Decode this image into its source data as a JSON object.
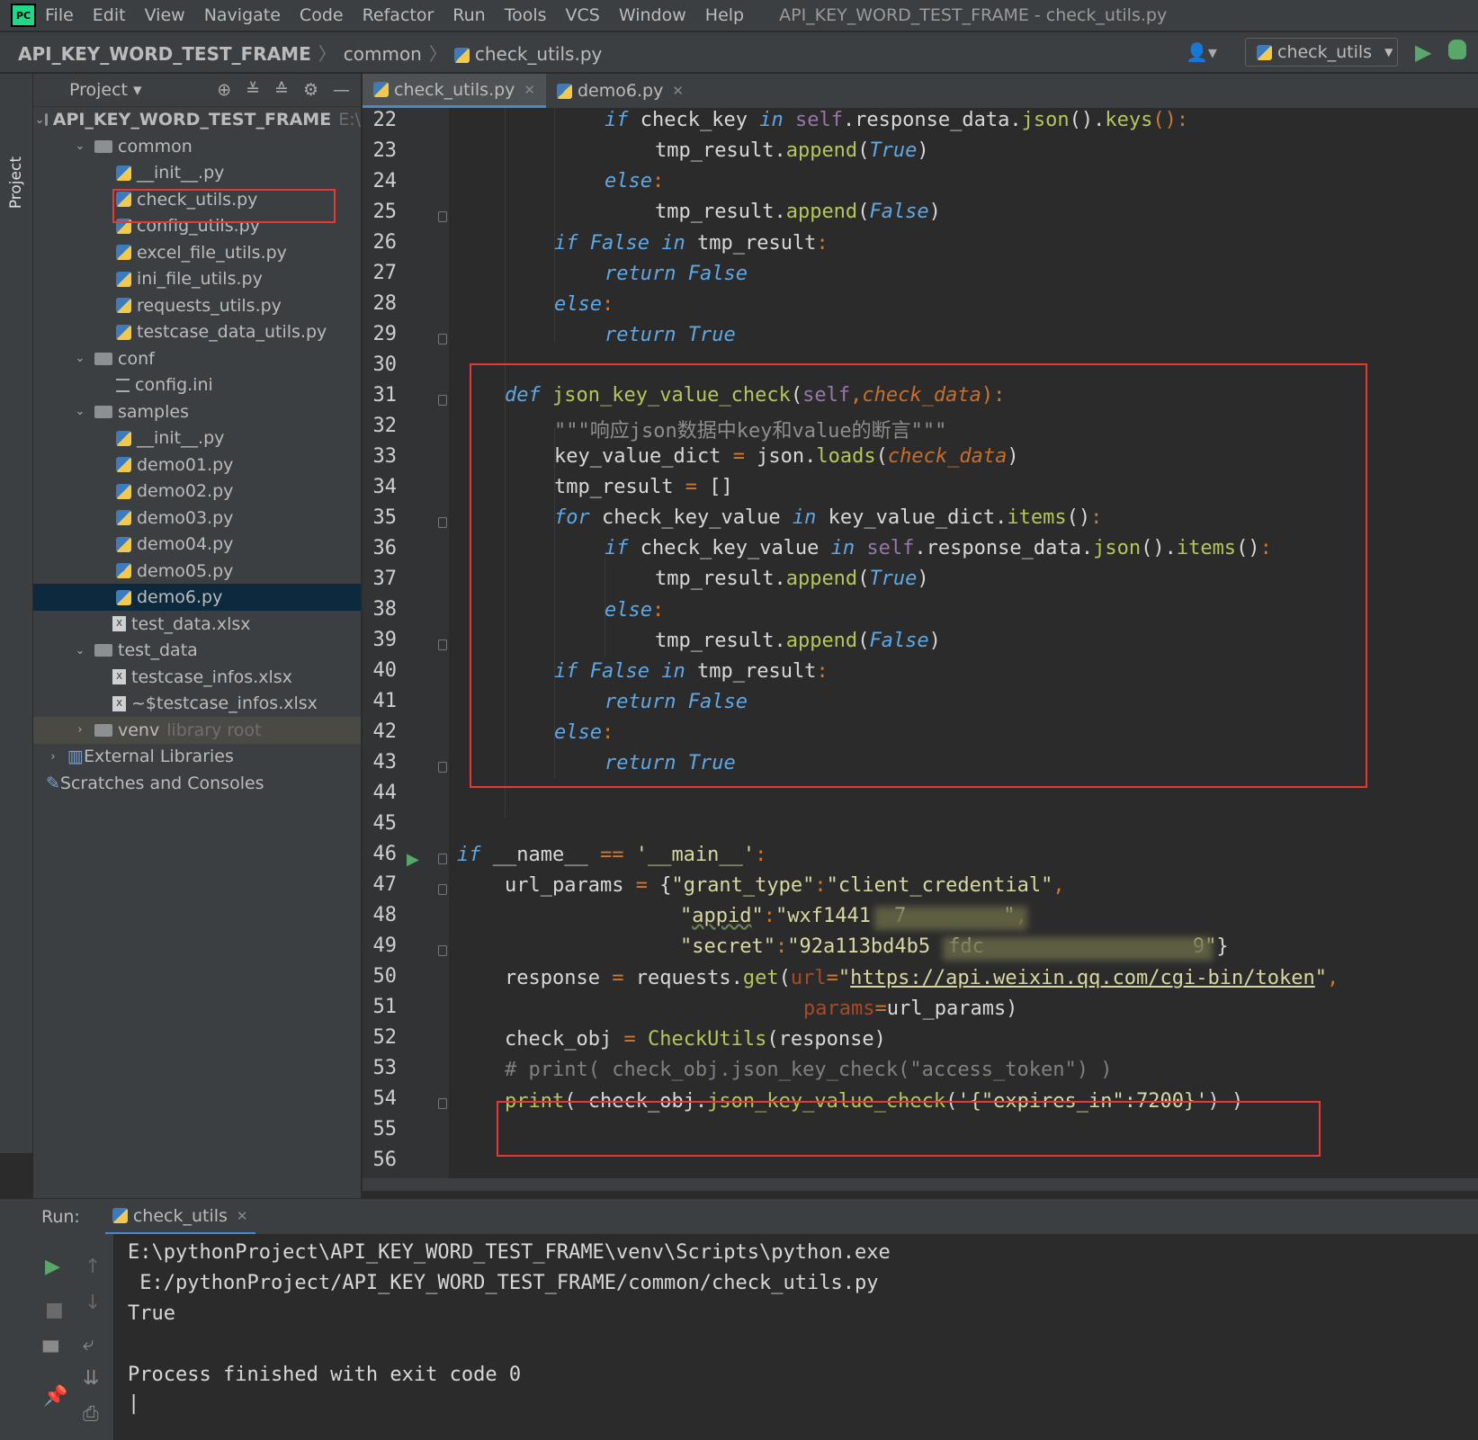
{
  "window_title": "API_KEY_WORD_TEST_FRAME - check_utils.py",
  "menu": [
    "File",
    "Edit",
    "View",
    "Navigate",
    "Code",
    "Refactor",
    "Run",
    "Tools",
    "VCS",
    "Window",
    "Help"
  ],
  "logo": "PC",
  "breadcrumb": {
    "project": "API_KEY_WORD_TEST_FRAME",
    "folder": "common",
    "file": "check_utils.py"
  },
  "run_config": "check_utils",
  "project_panel": {
    "title": "Project",
    "vertical_tab": "Project"
  },
  "tree": [
    {
      "label": "API_KEY_WORD_TEST_FRAME",
      "extra": "E:\\",
      "type": "root"
    },
    {
      "label": "common",
      "type": "folder"
    },
    {
      "label": "__init__.py",
      "type": "py"
    },
    {
      "label": "check_utils.py",
      "type": "py"
    },
    {
      "label": "config_utils.py",
      "type": "py"
    },
    {
      "label": "excel_file_utils.py",
      "type": "py"
    },
    {
      "label": "ini_file_utils.py",
      "type": "py"
    },
    {
      "label": "requests_utils.py",
      "type": "py"
    },
    {
      "label": "testcase_data_utils.py",
      "type": "py"
    },
    {
      "label": "conf",
      "type": "folder"
    },
    {
      "label": "config.ini",
      "type": "ini"
    },
    {
      "label": "samples",
      "type": "folder"
    },
    {
      "label": "__init__.py",
      "type": "py"
    },
    {
      "label": "demo01.py",
      "type": "py"
    },
    {
      "label": "demo02.py",
      "type": "py"
    },
    {
      "label": "demo03.py",
      "type": "py"
    },
    {
      "label": "demo04.py",
      "type": "py"
    },
    {
      "label": "demo05.py",
      "type": "py"
    },
    {
      "label": "demo6.py",
      "type": "py"
    },
    {
      "label": "test_data.xlsx",
      "type": "xls"
    },
    {
      "label": "test_data",
      "type": "folder"
    },
    {
      "label": "testcase_infos.xlsx",
      "type": "xls"
    },
    {
      "label": "~$testcase_infos.xlsx",
      "type": "xls"
    },
    {
      "label": "venv",
      "extra": "library root",
      "type": "folder"
    },
    {
      "label": "External Libraries",
      "type": "lib"
    },
    {
      "label": "Scratches and Consoles",
      "type": "scratch"
    }
  ],
  "tabs": [
    "check_utils.py",
    "demo6.py"
  ],
  "line_numbers": [
    "22",
    "23",
    "24",
    "25",
    "26",
    "27",
    "28",
    "29",
    "30",
    "31",
    "32",
    "33",
    "34",
    "35",
    "36",
    "37",
    "38",
    "39",
    "40",
    "41",
    "42",
    "43",
    "44",
    "45",
    "46",
    "47",
    "48",
    "49",
    "50",
    "51",
    "52",
    "53",
    "54",
    "55",
    "56"
  ],
  "code": {
    "l22": {
      "a": "if",
      "b": " check_key ",
      "c": "in",
      "d": " ",
      "e": "self",
      "f": ".response_data.",
      "g": "json",
      "h": "().",
      "i": "keys",
      "j": "():"
    },
    "l23": {
      "a": "tmp_result.",
      "b": "append",
      "c": "(",
      "d": "True",
      "e": ")"
    },
    "l24": {
      "a": "else",
      ":": ":"
    },
    "l25": {
      "a": "tmp_result.",
      "b": "append",
      "c": "(",
      "d": "False",
      "e": ")"
    },
    "l26": {
      "a": "if",
      "b": " ",
      "c": "False",
      "d": " ",
      "e": "in",
      "f": " tmp_result",
      ":": ":"
    },
    "l27": {
      "a": "return False"
    },
    "l28": {
      "a": "else",
      ":": ":"
    },
    "l29": {
      "a": "return True"
    },
    "l31": {
      "a": "def",
      "b": " ",
      "c": "json_key_value_check",
      "d": "(",
      "e": "self",
      ",": ",",
      "f": "check_data",
      "g": "):"
    },
    "l32": {
      "a": "\"\"\"响应json数据中key和value的断言\"\"\""
    },
    "l33": {
      "a": "key_value_dict ",
      "eq": "=",
      "b": " json.",
      "c": "loads",
      "d": "(",
      "e": "check_data",
      "f": ")"
    },
    "l34": {
      "a": "tmp_result ",
      "eq": "=",
      "b": " []"
    },
    "l35": {
      "a": "for",
      "b": " check_key_value ",
      "c": "in",
      "d": " key_value_dict.",
      "e": "items",
      "f": "()",
      ":": ":"
    },
    "l36": {
      "a": "if",
      "b": " check_key_value ",
      "c": "in",
      "d": " ",
      "e": "self",
      "f": ".response_data.",
      "g": "json",
      "h": "().",
      "i": "items",
      "j": "()",
      ":": ":"
    },
    "l37": {
      "a": "tmp_result.",
      "b": "append",
      "c": "(",
      "d": "True",
      "e": ")"
    },
    "l38": {
      "a": "else",
      ":": ":"
    },
    "l39": {
      "a": "tmp_result.",
      "b": "append",
      "c": "(",
      "d": "False",
      "e": ")"
    },
    "l40": {
      "a": "if",
      "b": " ",
      "c": "False",
      "d": " ",
      "e": "in",
      "f": " tmp_result",
      ":": ":"
    },
    "l41": {
      "a": "return False"
    },
    "l42": {
      "a": "else",
      ":": ":"
    },
    "l43": {
      "a": "return True"
    },
    "l46": {
      "a": "if",
      "b": " __name__ ",
      "eq": "==",
      "c": " ",
      "d": "'__main__'",
      ":": ":"
    },
    "l47": {
      "a": "url_params ",
      "eq": "=",
      "b": " {",
      "c": "\"grant_type\"",
      ":": ":",
      "d": "\"client_credential\"",
      ",": ","
    },
    "l48": {
      "a": "\"",
      "b": "appid",
      "c": "\"",
      ":": ":",
      "d": "\"wxf1441",
      "e": "7",
      "f": "\"",
      ",": ","
    },
    "l49": {
      "a": "\"secret\"",
      ":": ":",
      "b": "\"92a113bd4b5",
      "c": "fdc",
      "d": "9\"",
      "e": "}"
    },
    "l50": {
      "a": "response ",
      "eq": "=",
      "b": " requests.",
      "c": "get",
      "d": "(",
      "e": "url",
      "eq2": "=",
      "f": "\"",
      "g": "https://api.weixin.qq.com/cgi-bin/token",
      "h": "\"",
      ",": ","
    },
    "l51": {
      "a": "params",
      "eq": "=",
      "b": "url_params)"
    },
    "l52": {
      "a": "check_obj ",
      "eq": "=",
      "b": " ",
      "c": "CheckUtils",
      "d": "(response)"
    },
    "l53": {
      "a": "# print( check_obj.json_key_check(\"access_token\") )"
    },
    "l54": {
      "a": "print",
      "b": "( check_obj.",
      "c": "json_key_value_check",
      "d": "(",
      "e": "'{\"expires_in\":7200}'",
      "f": ") )"
    }
  },
  "run_panel": {
    "label": "Run:",
    "tab": "check_utils",
    "output": [
      "E:\\pythonProject\\API_KEY_WORD_TEST_FRAME\\venv\\Scripts\\python.exe",
      " E:/pythonProject/API_KEY_WORD_TEST_FRAME/common/check_utils.py",
      "True",
      "",
      "Process finished with exit code 0"
    ]
  },
  "colors": {
    "accent": "#4a88c7",
    "highlight_box": "#e53935",
    "run_green": "#59a869",
    "keyword": "#5fa8e6",
    "function": "#b7c65a"
  }
}
